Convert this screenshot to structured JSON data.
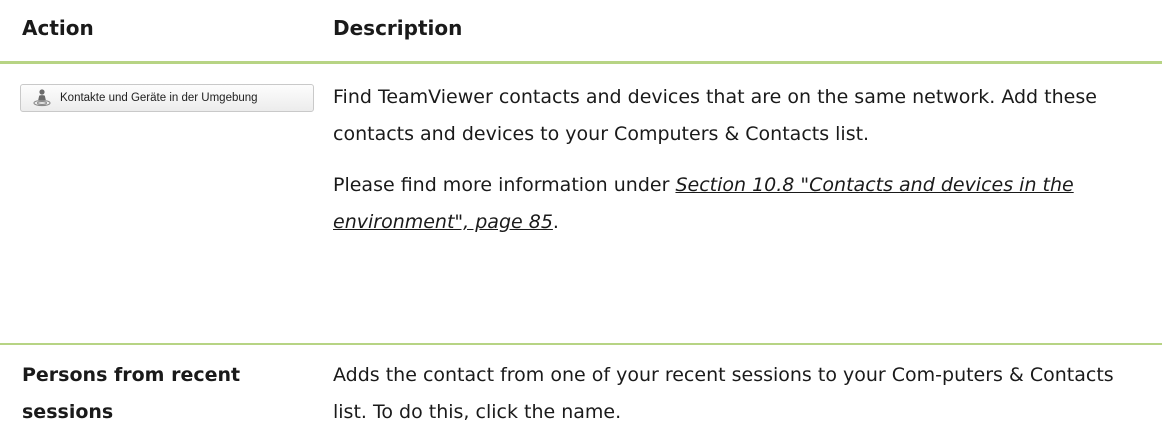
{
  "header": {
    "action": "Action",
    "description": "Description"
  },
  "rows": [
    {
      "action_button": {
        "label": "Kontakte und Geräte in der Umgebung",
        "icon": "nearby-contacts-icon"
      },
      "description_para1": "Find TeamViewer contacts and devices that are on the same network. Add these contacts and devices to your Computers & Contacts list.",
      "description_para2_prefix": "Please find more information under ",
      "description_para2_link": "Section 10.8 \"Contacts and devices in the environment\", page 85",
      "description_para2_suffix": "."
    },
    {
      "action_text": "Persons from recent sessions",
      "description": "Adds the contact from one of your recent sessions to your Com-puters & Contacts list. To do this, click the name."
    }
  ],
  "colors": {
    "rule": "#b7d484",
    "text": "#1a1a1a"
  }
}
